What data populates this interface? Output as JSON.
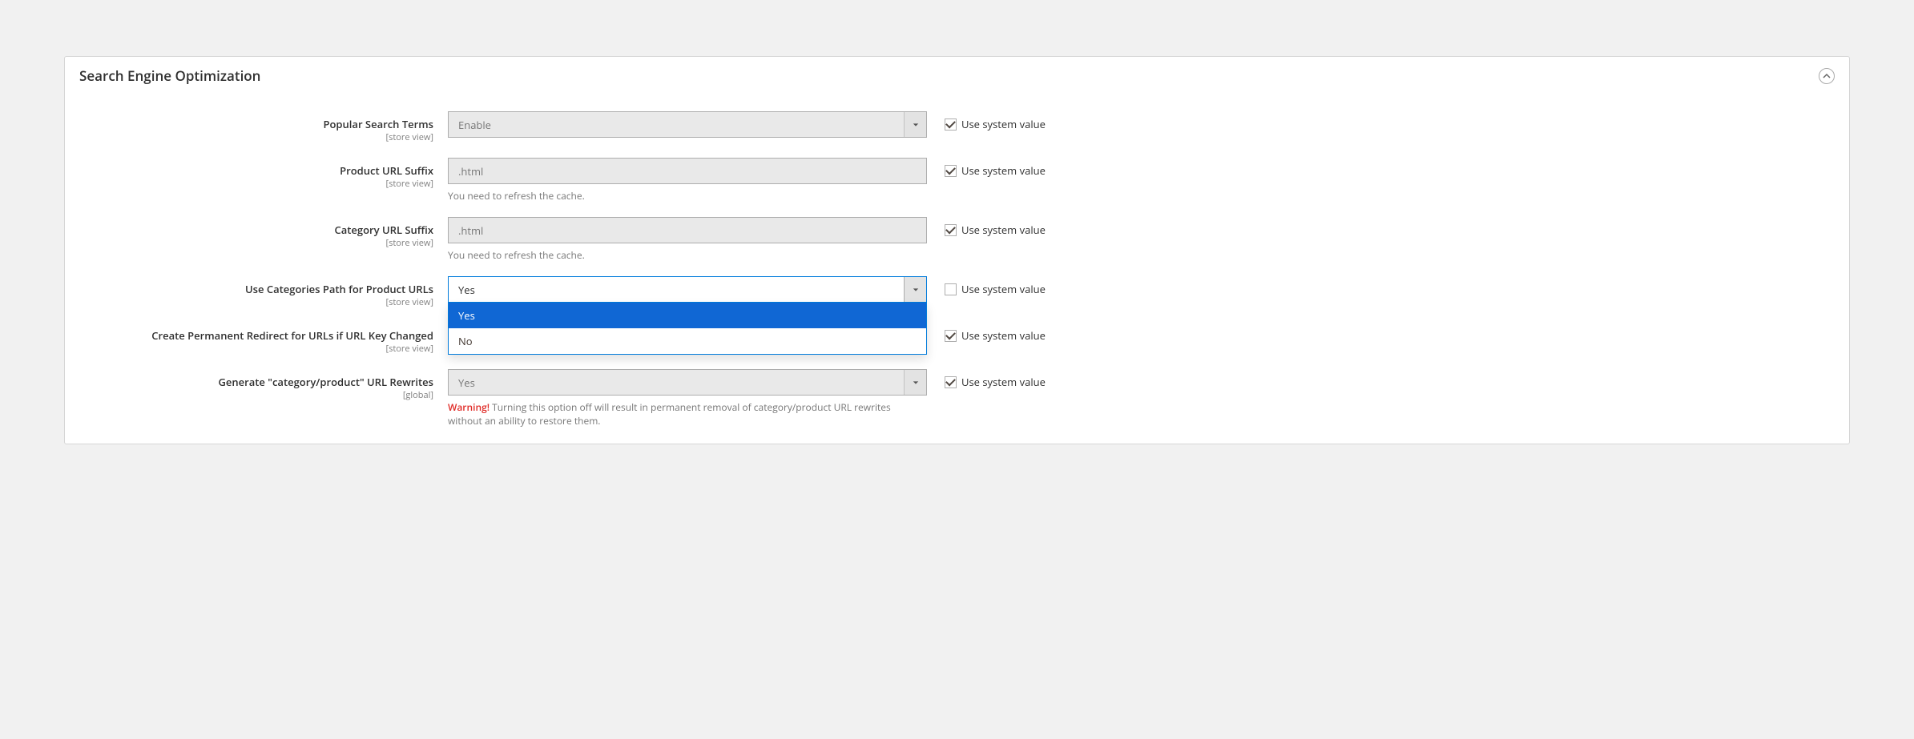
{
  "section": {
    "title": "Search Engine Optimization"
  },
  "labels": {
    "use_system_value": "Use system value",
    "scope_storeview": "[store view]",
    "scope_global": "[global]"
  },
  "fields": {
    "popular_search_terms": {
      "label": "Popular Search Terms",
      "value": "Enable",
      "use_system": true
    },
    "product_url_suffix": {
      "label": "Product URL Suffix",
      "value": ".html",
      "hint": "You need to refresh the cache.",
      "use_system": true
    },
    "category_url_suffix": {
      "label": "Category URL Suffix",
      "value": ".html",
      "hint": "You need to refresh the cache.",
      "use_system": true
    },
    "use_categories_path": {
      "label": "Use Categories Path for Product URLs",
      "value": "Yes",
      "use_system": false,
      "options": [
        "Yes",
        "No"
      ]
    },
    "create_redirect": {
      "label": "Create Permanent Redirect for URLs if URL Key Changed",
      "use_system": true
    },
    "generate_rewrites": {
      "label": "Generate \"category/product\" URL Rewrites",
      "value": "Yes",
      "use_system": true,
      "warn_prefix": "Warning!",
      "warn_text": " Turning this option off will result in permanent removal of category/product URL rewrites without an ability to restore them."
    }
  }
}
